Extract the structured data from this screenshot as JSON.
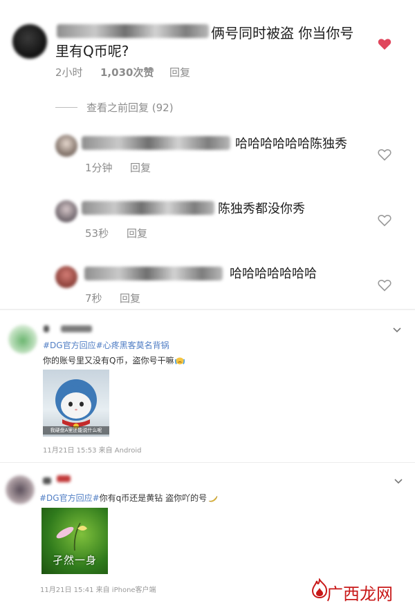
{
  "main_comment": {
    "text_line1": "俩号同时被盗 你当你号",
    "text_line2": "里有Q币呢?",
    "time": "2小时",
    "likes": "1,030次赞",
    "reply_label": "回复"
  },
  "view_previous": "查看之前回复 (92)",
  "replies": [
    {
      "text": "哈哈哈哈哈哈陈独秀",
      "time": "1分钟",
      "reply_label": "回复"
    },
    {
      "text": "陈独秀都没你秀",
      "time": "53秒",
      "reply_label": "回复"
    },
    {
      "text": "哈哈哈哈哈哈哈",
      "time": "7秒",
      "reply_label": "回复"
    }
  ],
  "posts": [
    {
      "tag": "#DG官方回应#心疼黑客莫名背锅",
      "body": "你的账号里又没有Q币，盗你号干嘛",
      "image_caption": "我硬盘A里还能说什么呢",
      "meta": "11月21日 15:53 来自 Android"
    },
    {
      "tag": "#DG官方回应#",
      "body_rest": "你有q币还是黄钻 盗你吖的号",
      "image_caption": "孑然一身",
      "meta": "11月21日 15:41 来自 iPhone客户端"
    }
  ],
  "watermark": "广西龙网",
  "colors": {
    "heart_active": "#e0465c",
    "tag_blue": "#4f7dc4",
    "watermark_red": "#c81818"
  }
}
